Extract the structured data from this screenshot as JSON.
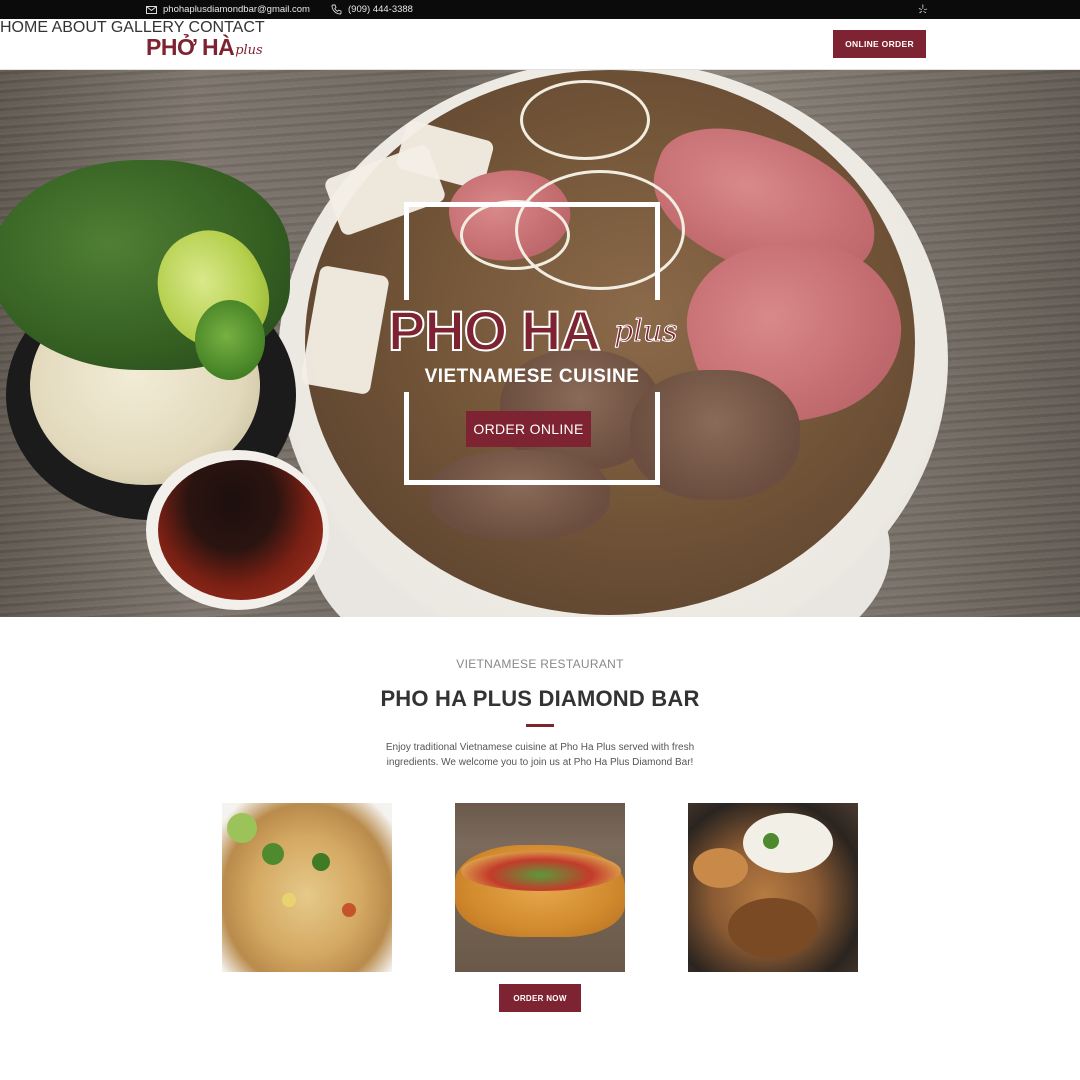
{
  "topbar": {
    "email": "phohaplusdiamondbar@gmail.com",
    "phone": "(909) 444-3388"
  },
  "header": {
    "logo_main": "PHỞ HÀ",
    "logo_script": "plus",
    "nav": [
      "HOME",
      "ABOUT",
      "GALLERY",
      "CONTACT"
    ],
    "order_button": "ONLINE ORDER"
  },
  "hero": {
    "title": "PHO HA",
    "title_script": "plus",
    "subtitle": "VIETNAMESE CUISINE",
    "cta": "ORDER ONLINE"
  },
  "intro": {
    "eyebrow": "VIETNAMESE RESTAURANT",
    "heading": "PHO HA PLUS DIAMOND BAR",
    "description": "Enjoy traditional Vietnamese cuisine at Pho Ha Plus served with fresh ingredients. We welcome you to join us at Pho Ha Plus Diamond Bar!",
    "order_now": "ORDER NOW"
  },
  "colors": {
    "brand": "#7e2332",
    "topbar": "#0b0b0b"
  },
  "icons": [
    "envelope-icon",
    "phone-icon",
    "yelp-icon"
  ]
}
